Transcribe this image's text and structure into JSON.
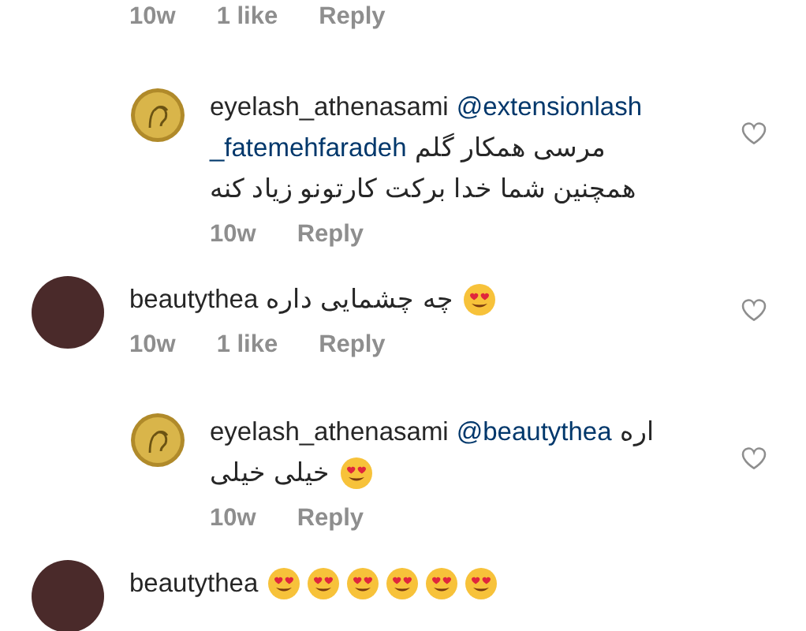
{
  "comments": [
    {
      "kind": "fragment",
      "heart": false,
      "meta": {
        "time": "10w",
        "likes": "1 like",
        "reply": "Reply"
      }
    },
    {
      "kind": "reply",
      "avatar": {
        "kind": "logo"
      },
      "heart": true,
      "lines": [
        [
          {
            "kind": "user",
            "text": "eyelash_athenasami"
          },
          {
            "kind": "mention",
            "text": "@extensionlash"
          }
        ],
        [
          {
            "kind": "mention",
            "text": "_fatemehfaradeh"
          },
          {
            "kind": "text",
            "text": "مرسی همکار گلم"
          }
        ],
        [
          {
            "kind": "text",
            "text": "همچنین شما خدا برکت کارتونو زیاد کنه"
          }
        ]
      ],
      "meta": {
        "time": "10w",
        "reply": "Reply"
      }
    },
    {
      "kind": "comment",
      "avatar": {
        "kind": "photo"
      },
      "heart": true,
      "lines": [
        [
          {
            "kind": "user",
            "text": "beautythea"
          },
          {
            "kind": "text",
            "text": "چه چشمایی داره"
          },
          {
            "kind": "emoji"
          }
        ]
      ],
      "meta": {
        "time": "10w",
        "likes": "1 like",
        "reply": "Reply"
      }
    },
    {
      "kind": "reply",
      "avatar": {
        "kind": "logo"
      },
      "heart": true,
      "lines": [
        [
          {
            "kind": "user",
            "text": "eyelash_athenasami"
          },
          {
            "kind": "mention",
            "text": "@beautythea"
          },
          {
            "kind": "text",
            "text": "اره"
          }
        ],
        [
          {
            "kind": "text",
            "text": "خیلی خیلی"
          },
          {
            "kind": "emoji"
          }
        ]
      ],
      "meta": {
        "time": "10w",
        "reply": "Reply"
      }
    },
    {
      "kind": "comment",
      "avatar": {
        "kind": "photo"
      },
      "heart": false,
      "lines": [
        [
          {
            "kind": "user",
            "text": "beautythea"
          },
          {
            "kind": "emoji"
          },
          {
            "kind": "emoji"
          },
          {
            "kind": "emoji"
          },
          {
            "kind": "emoji"
          },
          {
            "kind": "emoji"
          },
          {
            "kind": "emoji"
          }
        ]
      ]
    }
  ]
}
